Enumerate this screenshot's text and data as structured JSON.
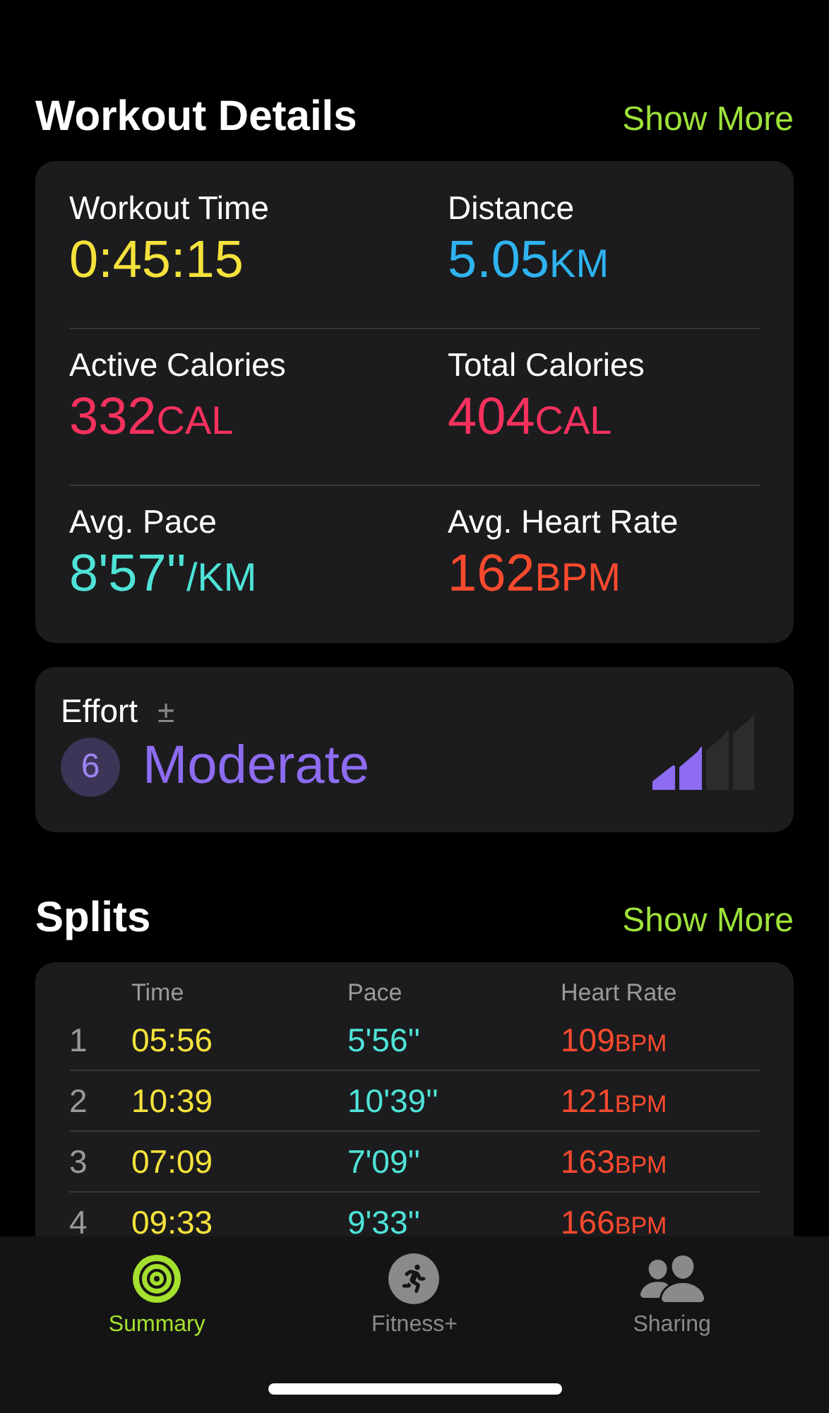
{
  "workout_details": {
    "title": "Workout Details",
    "action": "Show More",
    "metrics": [
      {
        "label": "Workout Time",
        "value": "0:45:15",
        "color": "#f5e23c"
      },
      {
        "label": "Distance",
        "value": "5.05",
        "unit": "KM",
        "color": "#2fb3f0"
      },
      {
        "label": "Active Calories",
        "value": "332",
        "unit": "CAL",
        "color": "#f7315e"
      },
      {
        "label": "Total Calories",
        "value": "404",
        "unit": "CAL",
        "color": "#f7315e"
      },
      {
        "label": "Avg. Pace",
        "value": "8'57''",
        "unit": "/KM",
        "color": "#4fe3d8"
      },
      {
        "label": "Avg. Heart Rate",
        "value": "162",
        "unit": "BPM",
        "color": "#fa4a2e"
      }
    ]
  },
  "effort": {
    "label": "Effort",
    "adjust": "±",
    "score": "6",
    "rating": "Moderate",
    "level": 0.5
  },
  "splits": {
    "title": "Splits",
    "action": "Show More",
    "columns": [
      "Time",
      "Pace",
      "Heart Rate"
    ],
    "rows": [
      {
        "index": "1",
        "time": "05:56",
        "pace": "5'56''",
        "heart_rate": "109",
        "unit": "BPM"
      },
      {
        "index": "2",
        "time": "10:39",
        "pace": "10'39''",
        "heart_rate": "121",
        "unit": "BPM"
      },
      {
        "index": "3",
        "time": "07:09",
        "pace": "7'09''",
        "heart_rate": "163",
        "unit": "BPM"
      },
      {
        "index": "4",
        "time": "09:33",
        "pace": "9'33''",
        "heart_rate": "166",
        "unit": "BPM"
      }
    ]
  },
  "tab_bar": [
    {
      "kind": "summary",
      "label": "Summary",
      "selected": true
    },
    {
      "kind": "fitness",
      "label": "Fitness+",
      "selected": false
    },
    {
      "kind": "sharing",
      "label": "Sharing",
      "selected": false
    }
  ]
}
